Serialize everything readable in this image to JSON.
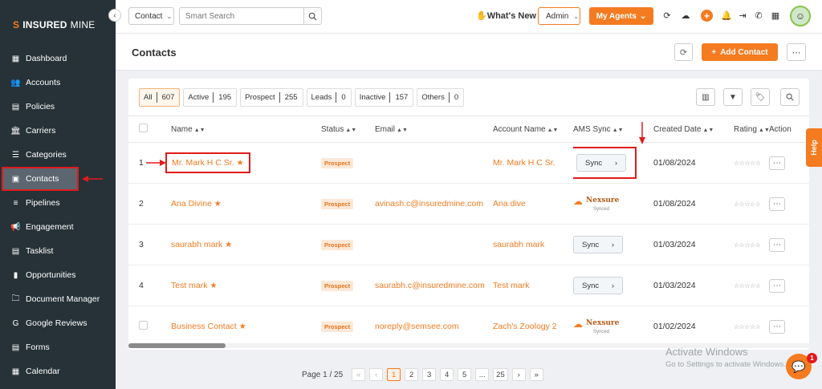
{
  "brand": {
    "mark": "S",
    "name_bold": "INSURED",
    "name_light": "MINE"
  },
  "sidebar": {
    "items": [
      {
        "label": "Dashboard",
        "icon": "dashboard-icon",
        "glyph": "▦"
      },
      {
        "label": "Accounts",
        "icon": "accounts-icon",
        "glyph": "👥"
      },
      {
        "label": "Policies",
        "icon": "policies-icon",
        "glyph": "▤"
      },
      {
        "label": "Carriers",
        "icon": "carriers-icon",
        "glyph": "🏛"
      },
      {
        "label": "Categories",
        "icon": "categories-icon",
        "glyph": "☰"
      },
      {
        "label": "Contacts",
        "icon": "contacts-icon",
        "glyph": "▣",
        "active": true
      },
      {
        "label": "Pipelines",
        "icon": "pipelines-icon",
        "glyph": "≡"
      },
      {
        "label": "Engagement",
        "icon": "megaphone-icon",
        "glyph": "📢"
      },
      {
        "label": "Tasklist",
        "icon": "tasklist-icon",
        "glyph": "▤"
      },
      {
        "label": "Opportunities",
        "icon": "opportunities-icon",
        "glyph": "▮"
      },
      {
        "label": "Document Manager",
        "icon": "folder-icon",
        "glyph": "🗀"
      },
      {
        "label": "Google Reviews",
        "icon": "google-icon",
        "glyph": "G"
      },
      {
        "label": "Forms",
        "icon": "forms-icon",
        "glyph": "▤"
      },
      {
        "label": "Calendar",
        "icon": "calendar-icon",
        "glyph": "▦"
      }
    ]
  },
  "topbar": {
    "search_scope": "Contact",
    "search_placeholder": "Smart Search",
    "whats_new": "What's New",
    "role": "Admin",
    "my_agents": "My Agents"
  },
  "page": {
    "title": "Contacts",
    "add_contact": "Add Contact"
  },
  "filters": [
    {
      "label": "All",
      "count": "607",
      "active": true
    },
    {
      "label": "Active",
      "count": "195"
    },
    {
      "label": "Prospect",
      "count": "255"
    },
    {
      "label": "Leads",
      "count": "0"
    },
    {
      "label": "Inactive",
      "count": "157"
    },
    {
      "label": "Others",
      "count": "0"
    }
  ],
  "table": {
    "headers": {
      "name": "Name",
      "status": "Status",
      "email": "Email",
      "account": "Account Name",
      "ams": "AMS Sync",
      "created": "Created Date",
      "rating": "Rating",
      "action": "Action"
    },
    "sync_label": "Sync",
    "nexsure_name": "Nexsure",
    "nexsure_sub": "Synced",
    "rows": [
      {
        "index": "1",
        "name": "Mr. Mark H C Sr.",
        "status": "Prospect",
        "email": "",
        "account": "Mr. Mark H C Sr.",
        "ams": "sync",
        "created": "01/08/2024",
        "rating": "☆☆☆☆☆"
      },
      {
        "index": "2",
        "name": "Ana Divine",
        "status": "Prospect",
        "email": "avinash.c@insuredmine.com",
        "account": "Ana dive",
        "ams": "nexsure",
        "created": "01/08/2024",
        "rating": "☆☆☆☆☆"
      },
      {
        "index": "3",
        "name": "saurabh mark",
        "status": "Prospect",
        "email": "",
        "account": "saurabh mark",
        "ams": "sync",
        "created": "01/03/2024",
        "rating": "☆☆☆☆☆"
      },
      {
        "index": "4",
        "name": "Test mark",
        "status": "Prospect",
        "email": "saurabh.c@insuredmine.com",
        "account": "Test mark",
        "ams": "sync",
        "created": "01/03/2024",
        "rating": "☆☆☆☆☆"
      },
      {
        "index": "",
        "name": "Business Contact",
        "status": "Prospect",
        "email": "noreply@semsee.com",
        "account": "Zach's Zoology 2",
        "ams": "nexsure",
        "created": "01/02/2024",
        "rating": "☆☆☆☆☆"
      }
    ]
  },
  "pagination": {
    "label": "Page 1 / 25",
    "first": "«",
    "prev": "‹",
    "pages": [
      "1",
      "2",
      "3",
      "4",
      "5",
      "...",
      "25"
    ],
    "next": "›",
    "last": "»",
    "current": "1"
  },
  "help": "Help",
  "watermark": {
    "line1": "Activate Windows",
    "line2": "Go to Settings to activate Windows."
  },
  "chat_badge": "1",
  "colors": {
    "accent": "#f47b20",
    "sidebar": "#263238",
    "highlight": "#e01b1b"
  }
}
